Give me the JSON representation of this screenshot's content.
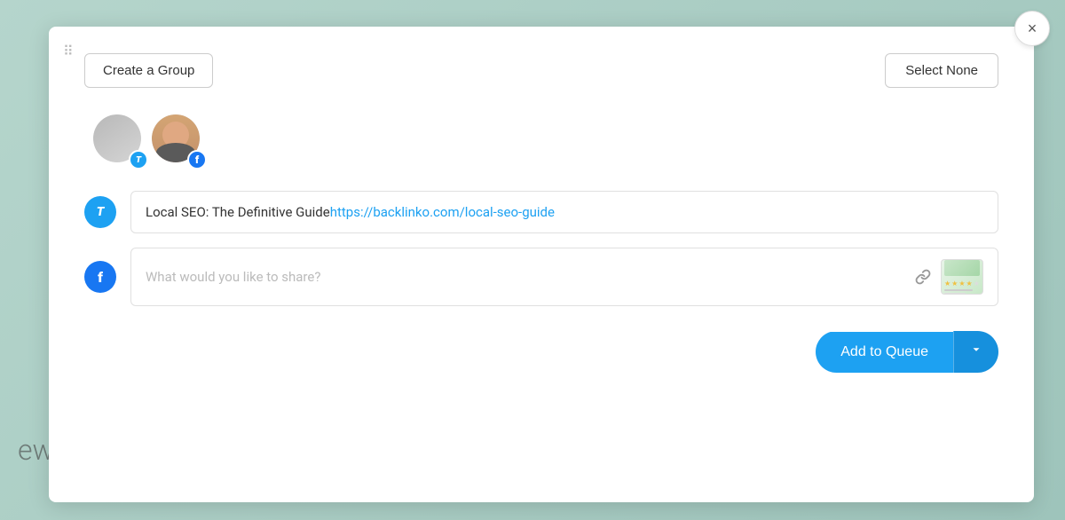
{
  "background": {
    "text": "ew guide I'll show you."
  },
  "modal": {
    "close_label": "×",
    "dots": "⠿",
    "header": {
      "create_group_label": "Create a Group",
      "select_none_label": "Select None"
    },
    "accounts": [
      {
        "type": "twitter",
        "badge": "T",
        "badge_type": "twitter"
      },
      {
        "type": "facebook",
        "badge": "f",
        "badge_type": "facebook"
      }
    ],
    "compose_rows": [
      {
        "platform": "twitter",
        "icon_label": "T",
        "content": "Local SEO: The Definitive Guide ",
        "link": "https://backlinko.com/local-seo-guide",
        "has_thumbnail": false
      },
      {
        "platform": "facebook",
        "icon_label": "f",
        "placeholder": "What would you like to share?",
        "has_thumbnail": true
      }
    ],
    "footer": {
      "add_to_queue_label": "Add to Queue",
      "arrow": "❯"
    }
  }
}
